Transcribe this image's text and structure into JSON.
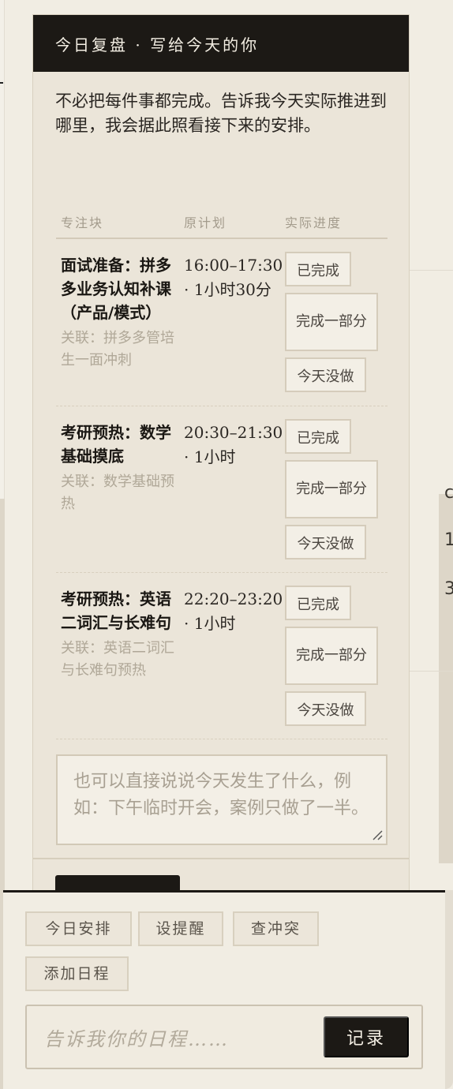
{
  "review_card": {
    "title": "今日复盘 · 写给今天的你",
    "intro": "不必把每件事都完成。告诉我今天实际推进到哪里，我会据此照看接下来的安排。",
    "columns": [
      "专注块",
      "原计划",
      "实际进度"
    ],
    "rows": [
      {
        "title": "面试准备：拼多多业务认知补课（产品/模式）",
        "link": "关联：拼多多管培生一面冲刺",
        "plan": "16:00–17:30 · 1小时30分",
        "done_label": "已完成",
        "partial_label": "完成一部分",
        "notdone_label": "今天没做"
      },
      {
        "title": "考研预热：数学基础摸底",
        "link": "关联：数学基础预热",
        "plan": "20:30–21:30 · 1小时",
        "done_label": "已完成",
        "partial_label": "完成一部分",
        "notdone_label": "今天没做"
      },
      {
        "title": "考研预热：英语二词汇与长难句",
        "link": "关联：英语二词汇与长难句预热",
        "plan": "22:20–23:20 · 1小时",
        "done_label": "已完成",
        "partial_label": "完成一部分",
        "notdone_label": "今天没做"
      }
    ],
    "note_placeholder": "也可以直接说说今天发生了什么，例如：下午临时开会，案例只做了一半。"
  },
  "quick_actions": [
    "今日安排",
    "设提醒",
    "查冲突",
    "添加日程"
  ],
  "composer": {
    "placeholder": "告诉我你的日程……",
    "send_label": "记录"
  },
  "background_glyphs": [
    "c",
    "1",
    "3"
  ]
}
